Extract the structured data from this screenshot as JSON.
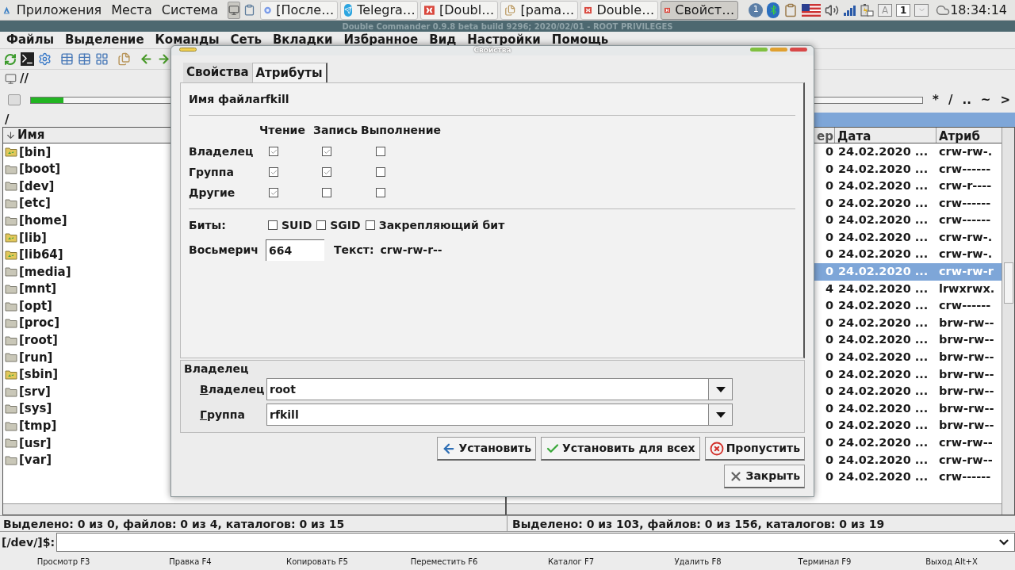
{
  "top_panel": {
    "menus": [
      "Приложения",
      "Места",
      "Система"
    ],
    "tasks": [
      {
        "label": "[После…",
        "kind": "browser",
        "selected": false
      },
      {
        "label": "Telegra…",
        "kind": "telegram",
        "selected": false
      },
      {
        "label": "[Doubl…",
        "kind": "commander",
        "selected": false
      },
      {
        "label": "[pama…",
        "kind": "files",
        "selected": false
      },
      {
        "label": "Double…",
        "kind": "commander",
        "selected": false
      },
      {
        "label": "Свойст…",
        "kind": "commander",
        "selected": true
      }
    ],
    "notifications": "1",
    "keys": [
      "A",
      "1"
    ],
    "clock": "18:34:14"
  },
  "window": {
    "title": "Double Commander 0.9.8 beta build 9296; 2020/02/01 - ROOT PRIVILEGES"
  },
  "menu": [
    "Файлы",
    "Выделение",
    "Команды",
    "Сеть",
    "Вкладки",
    "Избранное",
    "Вид",
    "Настройки",
    "Помощь"
  ],
  "drive_path": "//",
  "left_panel": {
    "disk_usage": {
      "level": 0.07
    },
    "path": "/",
    "column": "Имя",
    "items": [
      {
        "name": "[bin]",
        "kind": "link"
      },
      {
        "name": "[boot]",
        "kind": "folder"
      },
      {
        "name": "[dev]",
        "kind": "folder"
      },
      {
        "name": "[etc]",
        "kind": "folder"
      },
      {
        "name": "[home]",
        "kind": "folder"
      },
      {
        "name": "[lib]",
        "kind": "link"
      },
      {
        "name": "[lib64]",
        "kind": "link"
      },
      {
        "name": "[media]",
        "kind": "folder"
      },
      {
        "name": "[mnt]",
        "kind": "folder"
      },
      {
        "name": "[opt]",
        "kind": "folder"
      },
      {
        "name": "[proc]",
        "kind": "folder"
      },
      {
        "name": "[root]",
        "kind": "folder"
      },
      {
        "name": "[run]",
        "kind": "folder"
      },
      {
        "name": "[sbin]",
        "kind": "link"
      },
      {
        "name": "[srv]",
        "kind": "folder"
      },
      {
        "name": "[sys]",
        "kind": "folder"
      },
      {
        "name": "[tmp]",
        "kind": "folder"
      },
      {
        "name": "[usr]",
        "kind": "folder"
      },
      {
        "name": "[var]",
        "kind": "folder"
      }
    ],
    "status": "Выделено: 0 из 0, файлов: 0 из 4, каталогов: 0 из 15"
  },
  "right_panel": {
    "shortcuts": [
      "*",
      "/",
      "..",
      "~",
      ">"
    ],
    "columns": [
      "ер",
      "Дата",
      "Атриб"
    ],
    "rows": [
      {
        "size": "0",
        "date": "24.02.2020 ...",
        "attributes": "crw-rw-.",
        "selected": false
      },
      {
        "size": "0",
        "date": "24.02.2020 ...",
        "attributes": "crw------",
        "selected": false
      },
      {
        "size": "0",
        "date": "24.02.2020 ...",
        "attributes": "crw-r----",
        "selected": false
      },
      {
        "size": "0",
        "date": "24.02.2020 ...",
        "attributes": "crw------",
        "selected": false
      },
      {
        "size": "0",
        "date": "24.02.2020 ...",
        "attributes": "crw------",
        "selected": false
      },
      {
        "size": "0",
        "date": "24.02.2020 ...",
        "attributes": "crw-rw-.",
        "selected": false
      },
      {
        "size": "0",
        "date": "24.02.2020 ...",
        "attributes": "crw-rw-.",
        "selected": false
      },
      {
        "size": "0",
        "date": "24.02.2020 ...",
        "attributes": "crw-rw-r",
        "selected": true
      },
      {
        "size": "4",
        "date": "24.02.2020 ...",
        "attributes": "lrwxrwx.",
        "selected": false
      },
      {
        "size": "0",
        "date": "24.02.2020 ...",
        "attributes": "crw------",
        "selected": false
      },
      {
        "size": "0",
        "date": "24.02.2020 ...",
        "attributes": "brw-rw--",
        "selected": false
      },
      {
        "size": "0",
        "date": "24.02.2020 ...",
        "attributes": "brw-rw--",
        "selected": false
      },
      {
        "size": "0",
        "date": "24.02.2020 ...",
        "attributes": "brw-rw--",
        "selected": false
      },
      {
        "size": "0",
        "date": "24.02.2020 ...",
        "attributes": "brw-rw--",
        "selected": false
      },
      {
        "size": "0",
        "date": "24.02.2020 ...",
        "attributes": "brw-rw--",
        "selected": false
      },
      {
        "size": "0",
        "date": "24.02.2020 ...",
        "attributes": "brw-rw--",
        "selected": false
      },
      {
        "size": "0",
        "date": "24.02.2020 ...",
        "attributes": "brw-rw--",
        "selected": false
      },
      {
        "size": "0",
        "date": "24.02.2020 ...",
        "attributes": "crw-rw--",
        "selected": false
      },
      {
        "size": "0",
        "date": "24.02.2020 ...",
        "attributes": "crw-rw--",
        "selected": false
      },
      {
        "size": "0",
        "date": "24.02.2020 ...",
        "attributes": "crw------",
        "selected": false
      }
    ],
    "status": "Выделено: 0 из 103, файлов: 0 из 156, каталогов: 0 из 19"
  },
  "command_line": {
    "prompt": "[/dev/]$:"
  },
  "function_keys": [
    "Просмотр F3",
    "Правка F4",
    "Копировать F5",
    "Переместить F6",
    "Каталог F7",
    "Удалить F8",
    "Терминал F9",
    "Выход Alt+X"
  ],
  "dialog": {
    "title": "Свойства",
    "tabs": [
      {
        "label": "Свойства",
        "selected": false
      },
      {
        "label": "Атрибуты",
        "selected": true
      }
    ],
    "file_name_label": "Имя файла",
    "file_name": "rfkill",
    "permission_columns": [
      "Чтение",
      "Запись",
      "Выполнение"
    ],
    "permissions": [
      {
        "label": "Владелец",
        "read": true,
        "write": true,
        "execute": false
      },
      {
        "label": "Группа",
        "read": true,
        "write": true,
        "execute": false
      },
      {
        "label": "Другие",
        "read": true,
        "write": false,
        "execute": false
      }
    ],
    "bits_label": "Биты:",
    "bits": [
      {
        "label": "SUID",
        "checked": false
      },
      {
        "label": "SGID",
        "checked": false
      },
      {
        "label": "Закрепляющий бит",
        "checked": false
      }
    ],
    "octal_label": "Восьмерич",
    "octal_value": "664",
    "text_label": "Текст:",
    "text_value": "crw-rw-r--",
    "ownership": {
      "title": "Владелец",
      "fields": [
        {
          "label": "Владелец",
          "value": "root"
        },
        {
          "label": "Группа",
          "value": "rfkill"
        }
      ]
    },
    "buttons": [
      {
        "label": "Установить",
        "kind": "apply"
      },
      {
        "label": "Установить для всех",
        "kind": "apply_all"
      },
      {
        "label": "Пропустить",
        "kind": "skip"
      },
      {
        "label": "Закрыть",
        "kind": "close"
      }
    ]
  }
}
